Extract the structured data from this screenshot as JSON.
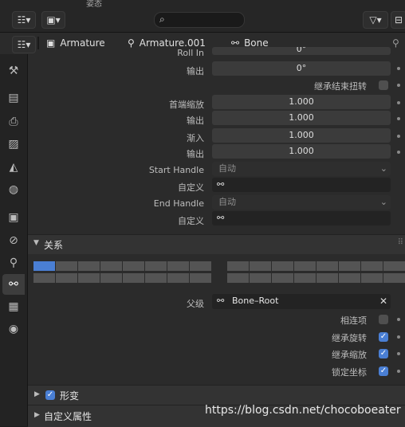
{
  "header": {
    "top_text": "姿态",
    "search_placeholder": ""
  },
  "breadcrumb": {
    "items": [
      {
        "label": "Armature",
        "icon": "armature-data-icon"
      },
      {
        "label": "Armature.001",
        "icon": "armature-object-icon"
      },
      {
        "label": "Bone",
        "icon": "bone-icon"
      }
    ]
  },
  "rows": [
    {
      "label": "Roll In",
      "value": "0°"
    },
    {
      "label": "输出",
      "value": "0°"
    },
    {
      "label": "继承结束扭转",
      "value": ""
    },
    {
      "label": "首端缩放",
      "value": "1.000"
    },
    {
      "label": "输出",
      "value": "1.000"
    },
    {
      "label": "渐入",
      "value": "1.000"
    },
    {
      "label": "输出",
      "value": "1.000"
    },
    {
      "label": "Start Handle",
      "value": "自动"
    },
    {
      "label": "自定义",
      "value": ""
    },
    {
      "label": "End Handle",
      "value": "自动"
    },
    {
      "label": "自定义",
      "value": ""
    }
  ],
  "relations": {
    "title": "关系",
    "parent_label": "父级",
    "parent_value": "Bone–Root",
    "connected_label": "相连项",
    "inherit_rotation_label": "继承旋转",
    "inherit_scale_label": "继承缩放",
    "lock_location_label": "锁定坐标",
    "connected": false,
    "inherit_rotation": true,
    "inherit_scale": true,
    "lock_location": true
  },
  "deform": {
    "title": "形变",
    "enabled": true
  },
  "custom_props": {
    "title": "自定义属性"
  },
  "watermark": "https://blog.csdn.net/chocoboeater",
  "colors": {
    "accent": "#4a7fd4",
    "panel": "#2b2b2b",
    "field": "#3b3b3b"
  }
}
